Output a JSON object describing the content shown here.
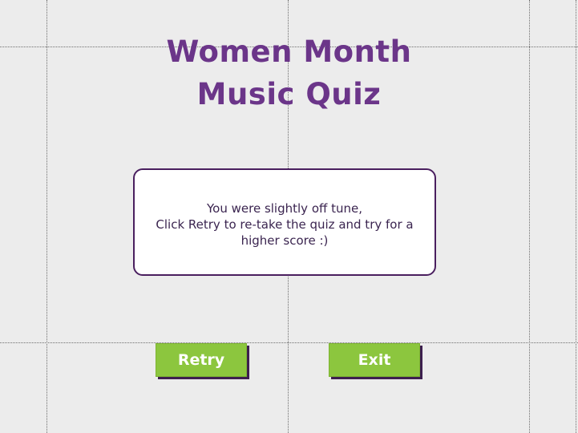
{
  "quiz": {
    "title_line_1": "Women Month",
    "title_line_2": "Music Quiz"
  },
  "result": {
    "line_1": "You were slightly off tune,",
    "line_2": "Click Retry to re-take the quiz and try for a",
    "line_3": "higher score :)"
  },
  "actions": {
    "retry_label": "Retry",
    "exit_label": "Exit"
  },
  "colors": {
    "background": "#ececec",
    "title": "#6b3589",
    "button": "#8cc63e",
    "button_shadow": "#3d1f4f",
    "box_border": "#4a1f5f"
  }
}
